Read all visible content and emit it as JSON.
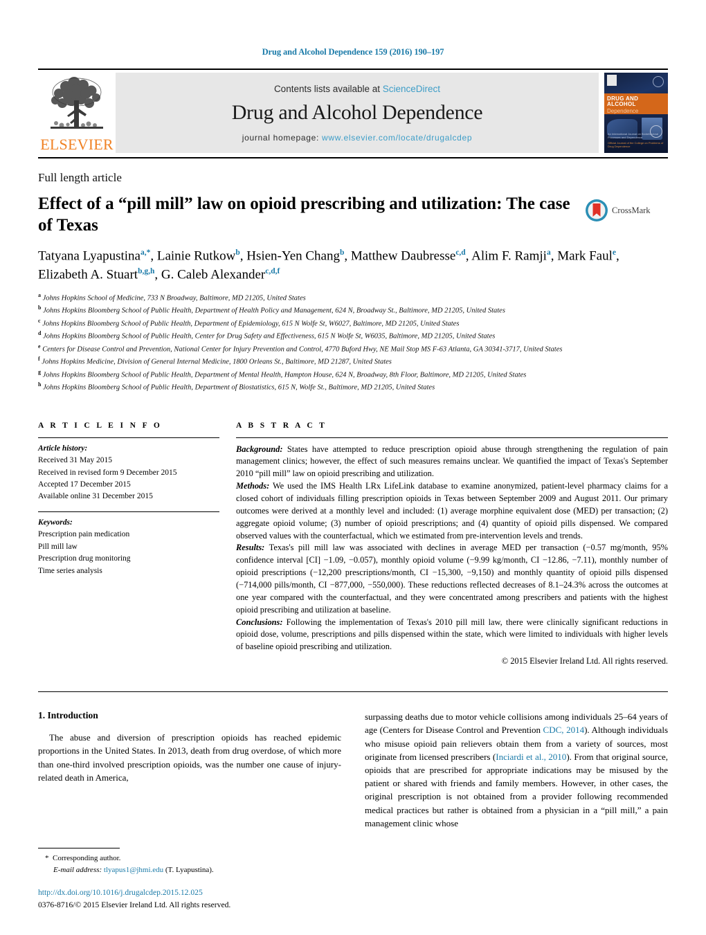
{
  "running_head": "Drug and Alcohol Dependence 159 (2016) 190–197",
  "masthead": {
    "publisher_wordmark": "ELSEVIER",
    "contents_prefix": "Contents lists available at ",
    "contents_link": "ScienceDirect",
    "journal_title": "Drug and Alcohol Dependence",
    "homepage_prefix": "journal homepage: ",
    "homepage_url": "www.elsevier.com/locate/drugalcdep",
    "cover": {
      "title_line1": "DRUG AND ALCOHOL",
      "title_line2": "Dependence",
      "caption": "An International Journal on Biobehavioral\nProcesses and Dependence",
      "footer": "Official Journal of the\nCollege on Problems of Drug Dependence"
    }
  },
  "article_type": "Full length article",
  "title": "Effect of a “pill mill” law on opioid prescribing and utilization: The case of Texas",
  "crossmark_label": "CrossMark",
  "authors": [
    {
      "name": "Tatyana Lyapustina",
      "marks": "a,*",
      "sep": ", "
    },
    {
      "name": "Lainie Rutkow",
      "marks": "b",
      "sep": ", "
    },
    {
      "name": "Hsien-Yen Chang",
      "marks": "b",
      "sep": ", "
    },
    {
      "name": "Matthew Daubresse",
      "marks": "c,d",
      "sep": ", "
    },
    {
      "name": "Alim F. Ramji",
      "marks": "a",
      "sep": ", "
    },
    {
      "name": "Mark Faul",
      "marks": "e",
      "sep": ", "
    },
    {
      "name": "Elizabeth A. Stuart",
      "marks": "b,g,h",
      "sep": ", "
    },
    {
      "name": "G. Caleb Alexander",
      "marks": "c,d,f",
      "sep": ""
    }
  ],
  "affiliations": [
    {
      "mark": "a",
      "text": "Johns Hopkins School of Medicine, 733 N Broadway, Baltimore, MD 21205, United States"
    },
    {
      "mark": "b",
      "text": "Johns Hopkins Bloomberg School of Public Health, Department of Health Policy and Management, 624 N, Broadway St., Baltimore, MD 21205, United States"
    },
    {
      "mark": "c",
      "text": "Johns Hopkins Bloomberg School of Public Health, Department of Epidemiology, 615 N Wolfe St, W6027, Baltimore, MD 21205, United States"
    },
    {
      "mark": "d",
      "text": "Johns Hopkins Bloomberg School of Public Health, Center for Drug Safety and Effectiveness, 615 N Wolfe St, W6035, Baltimore, MD 21205, United States"
    },
    {
      "mark": "e",
      "text": "Centers for Disease Control and Prevention, National Center for Injury Prevention and Control, 4770 Buford Hwy, NE Mail Stop MS F-63 Atlanta, GA 30341-3717, United States"
    },
    {
      "mark": "f",
      "text": "Johns Hopkins Medicine, Division of General Internal Medicine, 1800 Orleans St., Baltimore, MD 21287, United States"
    },
    {
      "mark": "g",
      "text": "Johns Hopkins Bloomberg School of Public Health, Department of Mental Health, Hampton House, 624 N, Broadway, 8th Floor, Baltimore, MD 21205, United States"
    },
    {
      "mark": "h",
      "text": "Johns Hopkins Bloomberg School of Public Health, Department of Biostatistics, 615 N, Wolfe St., Baltimore, MD 21205, United States"
    }
  ],
  "article_info": {
    "heading": "A R T I C L E    I N F O",
    "history_label": "Article history:",
    "history": [
      "Received 31 May 2015",
      "Received in revised form 9 December 2015",
      "Accepted 17 December 2015",
      "Available online 31 December 2015"
    ],
    "keywords_label": "Keywords:",
    "keywords": [
      "Prescription pain medication",
      "Pill mill law",
      "Prescription drug monitoring",
      "Time series analysis"
    ]
  },
  "abstract": {
    "heading": "A B S T R A C T",
    "background_label": "Background:",
    "background": " States have attempted to reduce prescription opioid abuse through strengthening the regulation of pain management clinics; however, the effect of such measures remains unclear. We quantified the impact of Texas's September 2010 “pill mill” law on opioid prescribing and utilization.",
    "methods_label": "Methods:",
    "methods": " We used the IMS Health LRx LifeLink database to examine anonymized, patient-level pharmacy claims for a closed cohort of individuals filling prescription opioids in Texas between September 2009 and August 2011. Our primary outcomes were derived at a monthly level and included: (1) average morphine equivalent dose (MED) per transaction; (2) aggregate opioid volume; (3) number of opioid prescriptions; and (4) quantity of opioid pills dispensed. We compared observed values with the counterfactual, which we estimated from pre-intervention levels and trends.",
    "results_label": "Results:",
    "results": " Texas's pill mill law was associated with declines in average MED per transaction (−0.57 mg/month, 95% confidence interval [CI] −1.09, −0.057), monthly opioid volume (−9.99 kg/month, CI −12.86, −7.11), monthly number of opioid prescriptions (−12,200 prescriptions/month, CI −15,300, −9,150) and monthly quantity of opioid pills dispensed (−714,000 pills/month, CI −877,000, −550,000). These reductions reflected decreases of 8.1–24.3% across the outcomes at one year compared with the counterfactual, and they were concentrated among prescribers and patients with the highest opioid prescribing and utilization at baseline.",
    "conclusions_label": "Conclusions:",
    "conclusions": " Following the implementation of Texas's 2010 pill mill law, there were clinically significant reductions in opioid dose, volume, prescriptions and pills dispensed within the state, which were limited to individuals with higher levels of baseline opioid prescribing and utilization.",
    "copyright": "© 2015 Elsevier Ireland Ltd. All rights reserved."
  },
  "introduction": {
    "heading": "1.  Introduction",
    "left_paragraph": "The abuse and diversion of prescription opioids has reached epidemic proportions in the United States. In 2013, death from drug overdose, of which more than one-third involved prescription opioids, was the number one cause of injury-related death in America,",
    "right_part1": "surpassing deaths due to motor vehicle collisions among individuals 25–64 years of age (Centers for Disease Control and Prevention ",
    "right_link1": "CDC, 2014",
    "right_part2": "). Although individuals who misuse opioid pain relievers obtain them from a variety of sources, most originate from licensed prescribers (",
    "right_link2": "Inciardi et al., 2010",
    "right_part3": "). From that original source, opioids that are prescribed for appropriate indications may be misused by the patient or shared with friends and family members. However, in other cases, the original prescription is not obtained from a provider following recommended medical practices but rather is obtained from a physician in a “pill mill,” a pain management clinic whose"
  },
  "footnote": {
    "star": "*",
    "corresponding": "Corresponding author.",
    "email_label": "E-mail address:",
    "email": "tlyapus1@jhmi.edu",
    "email_suffix": " (T. Lyapustina)."
  },
  "doi_line": "http://dx.doi.org/10.1016/j.drugalcdep.2015.12.025",
  "issn_line": "0376-8716/© 2015 Elsevier Ireland Ltd. All rights reserved.",
  "colors": {
    "link_blue": "#1a7aa8",
    "sciencedirect_blue": "#3d9dc7",
    "elsevier_orange": "#f08224",
    "band_gray": "#e7e7e7",
    "crossmark_red": "#e03127",
    "crossmark_teal": "#2b8fb5"
  }
}
